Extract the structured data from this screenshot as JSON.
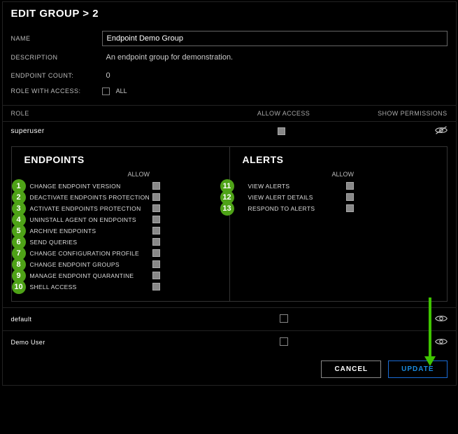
{
  "breadcrumb": {
    "title": "EDIT GROUP",
    "sep": ">",
    "step": "2"
  },
  "form": {
    "name_label": "NAME",
    "name_value": "Endpoint Demo Group",
    "desc_label": "DESCRIPTION",
    "desc_value": "An endpoint group for demonstration.",
    "count_label": "ENDPOINT COUNT:",
    "count_value": "0",
    "access_label": "ROLE WITH ACCESS:",
    "access_all": "ALL"
  },
  "role_header": {
    "col1": "ROLE",
    "col2": "ALLOW ACCESS",
    "col3": "SHOW PERMISSIONS"
  },
  "roles": [
    {
      "name": "superuser",
      "allow": true,
      "show_hidden": true
    }
  ],
  "perm_sections": {
    "endpoints": {
      "title": "ENDPOINTS",
      "allow_label": "ALLOW",
      "items": [
        {
          "n": "1",
          "label": "CHANGE ENDPOINT VERSION"
        },
        {
          "n": "2",
          "label": "DEACTIVATE ENDPOINTS PROTECTION"
        },
        {
          "n": "3",
          "label": "ACTIVATE ENDPOINTS PROTECTION"
        },
        {
          "n": "4",
          "label": "UNINSTALL AGENT ON ENDPOINTS"
        },
        {
          "n": "5",
          "label": "ARCHIVE ENDPOINTS"
        },
        {
          "n": "6",
          "label": "SEND QUERIES"
        },
        {
          "n": "7",
          "label": "CHANGE CONFIGURATION PROFILE"
        },
        {
          "n": "8",
          "label": "CHANGE ENDPOINT GROUPS"
        },
        {
          "n": "9",
          "label": "MANAGE ENDPOINT QUARANTINE"
        },
        {
          "n": "10",
          "label": "SHELL ACCESS"
        }
      ]
    },
    "alerts": {
      "title": "ALERTS",
      "allow_label": "ALLOW",
      "items": [
        {
          "n": "11",
          "label": "VIEW ALERTS"
        },
        {
          "n": "12",
          "label": "VIEW ALERT DETAILS"
        },
        {
          "n": "13",
          "label": "RESPOND TO ALERTS"
        }
      ]
    }
  },
  "bottom_roles": [
    {
      "name": "default",
      "allow": false
    },
    {
      "name": "Demo User",
      "allow": false
    }
  ],
  "buttons": {
    "cancel": "CANCEL",
    "update": "UPDATE"
  }
}
